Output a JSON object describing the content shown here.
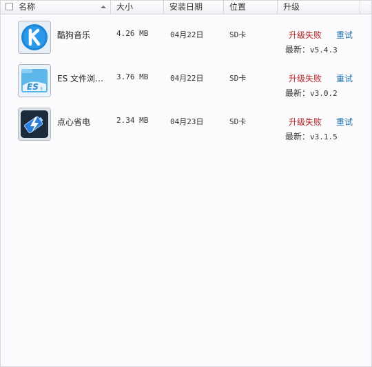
{
  "header": {
    "name": "名称",
    "size": "大小",
    "install_date": "安装日期",
    "location": "位置",
    "upgrade": "升级"
  },
  "apps": [
    {
      "name": "酷狗音乐",
      "size": "4.26 MB",
      "date": "04月22日",
      "location": "SD卡",
      "status": "升级失败",
      "retry": "重试",
      "latest_label": "最新：",
      "latest_version": "v5.4.3",
      "icon": "kugou-icon"
    },
    {
      "name": "ES 文件浏…",
      "size": "3.76 MB",
      "date": "04月22日",
      "location": "SD卡",
      "status": "升级失败",
      "retry": "重试",
      "latest_label": "最新：",
      "latest_version": "v3.0.2",
      "icon": "es-file-explorer-icon"
    },
    {
      "name": "点心省电",
      "size": "2.34 MB",
      "date": "04月23日",
      "location": "SD卡",
      "status": "升级失败",
      "retry": "重试",
      "latest_label": "最新：",
      "latest_version": "v3.1.5",
      "icon": "battery-saver-icon"
    }
  ],
  "colors": {
    "status_failed": "#b22222",
    "retry_link": "#1e6fa8"
  }
}
